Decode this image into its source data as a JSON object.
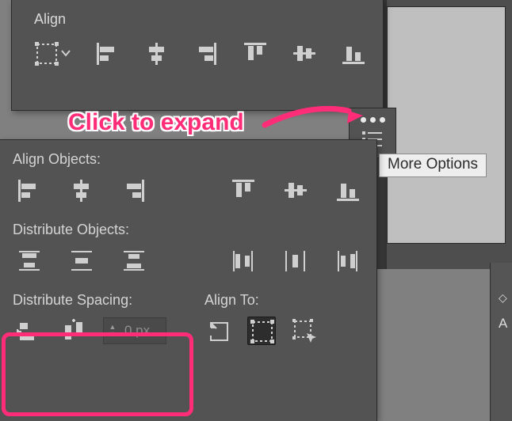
{
  "rightPeek": {
    "letter": "A"
  },
  "annotation": {
    "text": "Click to expand"
  },
  "tooltip": {
    "text": "More Options"
  },
  "alignTop": {
    "title": "Align",
    "icons": [
      "align-to-selection-icon",
      "align-left-icon",
      "align-h-center-icon",
      "align-right-icon",
      "align-top-icon",
      "align-v-center-icon",
      "align-bottom-icon"
    ]
  },
  "flyout": {
    "more": "more-options-icon",
    "list": "panel-menu-icon"
  },
  "expanded": {
    "alignObjects": {
      "label": "Align Objects:",
      "left": [
        "align-left-icon",
        "align-h-center-icon",
        "align-right-icon"
      ],
      "right": [
        "align-top-icon",
        "align-v-center-icon",
        "align-bottom-icon"
      ]
    },
    "distributeObjects": {
      "label": "Distribute Objects:",
      "left": [
        "dist-top-icon",
        "dist-v-center-icon",
        "dist-bottom-icon"
      ],
      "right": [
        "dist-left-icon",
        "dist-h-center-icon",
        "dist-right-icon"
      ]
    },
    "distributeSpacing": {
      "label": "Distribute Spacing:",
      "icons": [
        "dist-space-v-icon",
        "dist-space-h-icon"
      ],
      "value": "0 px"
    },
    "alignTo": {
      "label": "Align To:",
      "icons": [
        "align-to-artboard-icon",
        "align-to-selection-icon",
        "align-to-key-object-icon"
      ],
      "selectedIndex": 1
    }
  }
}
